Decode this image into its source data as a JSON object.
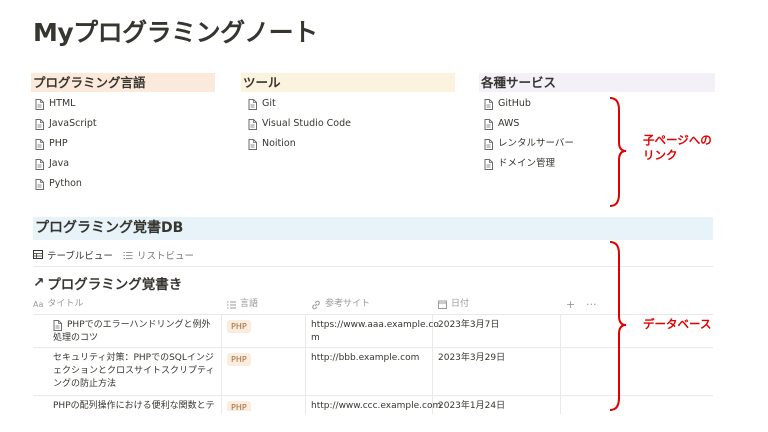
{
  "page": {
    "title": "Myプログラミングノート"
  },
  "columns": [
    {
      "heading": "プログラミング言語",
      "color": "#fbeadb",
      "items": [
        "HTML",
        "JavaScript",
        "PHP",
        "Java",
        "Python"
      ]
    },
    {
      "heading": "ツール",
      "color": "#fbf3dd",
      "items": [
        "Git",
        "Visual Studio Code",
        "Noition"
      ]
    },
    {
      "heading": "各種サービス",
      "color": "#f3f0f8",
      "items": [
        "GitHub",
        "AWS",
        "レンタルサーバー",
        "ドメイン管理"
      ]
    }
  ],
  "database": {
    "section_title": "プログラミング覚書DB",
    "views": [
      "テーブルビュー",
      "リストビュー"
    ],
    "title_arrow": "↗",
    "title": "プログラミング覚書き",
    "headers": {
      "title": "タイトル",
      "lang": "言語",
      "site": "参考サイト",
      "date": "日付",
      "add": "+",
      "more": "···"
    },
    "rows": [
      {
        "title_l1": "PHPでのエラーハンドリングと例外",
        "title_l2": "処理のコツ",
        "lang": "PHP",
        "site_l1": "https://www.aaa.example.co",
        "site_l2": "m",
        "date": "2023年3月7日"
      },
      {
        "title_l1": "セキュリティ対策：PHPでのSQLインジ",
        "title_l2": "ェクションとクロスサイトスクリプティ",
        "title_l3": "ングの防止方法",
        "lang": "PHP",
        "site_l1": "http://bbb.example.com",
        "date": "2023年3月29日"
      },
      {
        "title_l1": "PHPの配列操作における便利な関数とテ",
        "lang": "PHP",
        "site_l1": "http://www.ccc.example.com",
        "date": "2023年1月24日"
      }
    ]
  },
  "annotations": {
    "child_pages": [
      "子ページへの",
      "リンク"
    ],
    "database": "データベース",
    "color": "#e00000"
  }
}
